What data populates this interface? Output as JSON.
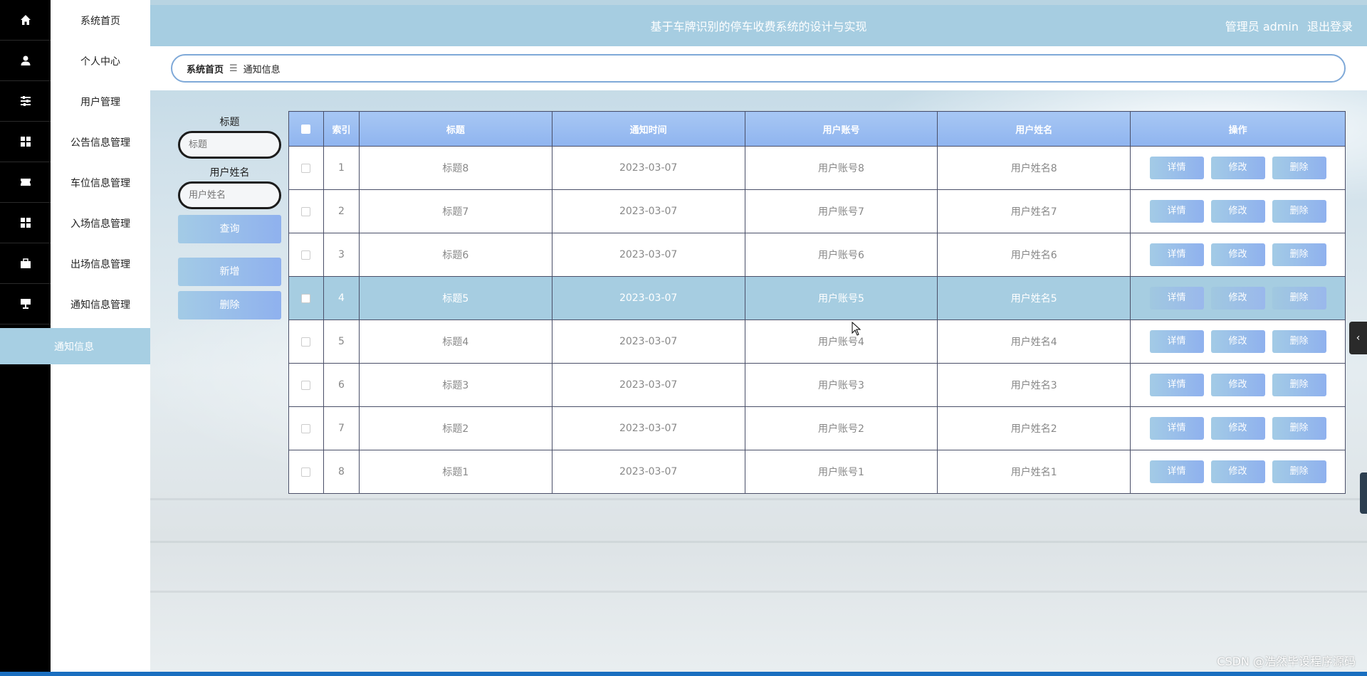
{
  "rail_icons": [
    "home-icon",
    "user-icon",
    "sliders-icon",
    "grid-icon",
    "ticket-icon",
    "grid-icon",
    "briefcase-icon",
    "sign-icon"
  ],
  "menu": {
    "items": [
      "系统首页",
      "个人中心",
      "用户管理",
      "公告信息管理",
      "车位信息管理",
      "入场信息管理",
      "出场信息管理",
      "通知信息管理"
    ],
    "active_sub": "通知信息"
  },
  "header": {
    "title": "基于车牌识别的停车收费系统的设计与实现",
    "user": "管理员 admin",
    "logout": "退出登录"
  },
  "breadcrumb": {
    "home": "系统首页",
    "separator": "☰",
    "current": "通知信息"
  },
  "search": {
    "title_label": "标题",
    "title_placeholder": "标题",
    "name_label": "用户姓名",
    "name_placeholder": "用户姓名",
    "query_btn": "查询",
    "add_btn": "新增",
    "delete_btn": "删除"
  },
  "table": {
    "headers": [
      "索引",
      "标题",
      "通知时间",
      "用户账号",
      "用户姓名",
      "操作"
    ],
    "actions": {
      "detail": "详情",
      "edit": "修改",
      "delete": "删除"
    },
    "rows": [
      {
        "index": "1",
        "title": "标题8",
        "time": "2023-03-07",
        "account": "用户账号8",
        "name": "用户姓名8"
      },
      {
        "index": "2",
        "title": "标题7",
        "time": "2023-03-07",
        "account": "用户账号7",
        "name": "用户姓名7"
      },
      {
        "index": "3",
        "title": "标题6",
        "time": "2023-03-07",
        "account": "用户账号6",
        "name": "用户姓名6"
      },
      {
        "index": "4",
        "title": "标题5",
        "time": "2023-03-07",
        "account": "用户账号5",
        "name": "用户姓名5"
      },
      {
        "index": "5",
        "title": "标题4",
        "time": "2023-03-07",
        "account": "用户账号4",
        "name": "用户姓名4"
      },
      {
        "index": "6",
        "title": "标题3",
        "time": "2023-03-07",
        "account": "用户账号3",
        "name": "用户姓名3"
      },
      {
        "index": "7",
        "title": "标题2",
        "time": "2023-03-07",
        "account": "用户账号2",
        "name": "用户姓名2"
      },
      {
        "index": "8",
        "title": "标题1",
        "time": "2023-03-07",
        "account": "用户账号1",
        "name": "用户姓名1"
      }
    ]
  },
  "collapse_icon": "chevron-left-icon",
  "watermark": "CSDN @浩然毕设程序源码"
}
